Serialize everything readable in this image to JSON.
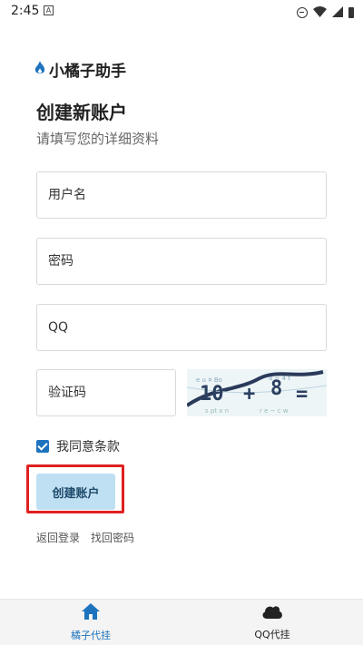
{
  "status_bar": {
    "time": "2:45",
    "notification_glyph": "A"
  },
  "brand": {
    "name": "小橘子助手",
    "icon": "flame-icon",
    "icon_color": "#1e73be"
  },
  "header": {
    "title": "创建新账户",
    "subtitle": "请填写您的详细资料"
  },
  "form": {
    "username_placeholder": "用户名",
    "password_placeholder": "密码",
    "qq_placeholder": "QQ",
    "captcha_placeholder": "验证码",
    "captcha_text": [
      "10",
      "+",
      "8",
      "="
    ],
    "agree_label": "我同意条款",
    "agree_checked": true,
    "submit_label": "创建账户"
  },
  "links": {
    "back_login": "返回登录",
    "recover_password": "找回密码"
  },
  "bottom_nav": [
    {
      "label": "橘子代挂",
      "icon": "home-icon",
      "active": true
    },
    {
      "label": "QQ代挂",
      "icon": "cloud-icon",
      "active": false
    }
  ],
  "colors": {
    "accent": "#1e73be",
    "button_bg": "#bfe0f2",
    "highlight": "#e02020"
  }
}
